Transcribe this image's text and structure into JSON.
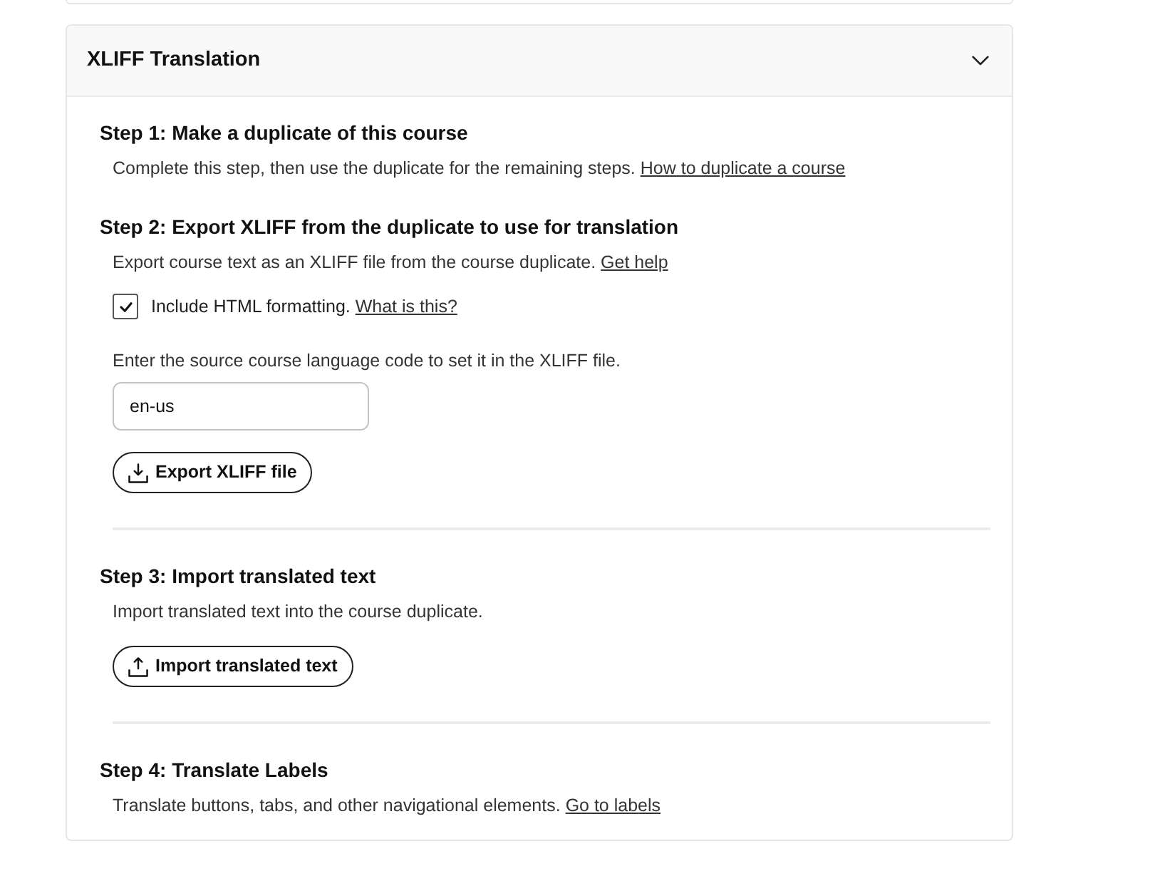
{
  "section": {
    "title": "XLIFF Translation",
    "expanded": true
  },
  "steps": [
    {
      "heading": "Step 1: Make a duplicate of this course",
      "divider_above": false,
      "description": "Complete this step, then use the duplicate for the remaining steps.",
      "link": "How to duplicate a course"
    },
    {
      "heading": "Step 2: Export XLIFF from the duplicate to use for translation",
      "divider_above": false,
      "description": "Export course text as an XLIFF file from the course duplicate.",
      "link": "Get help",
      "checkbox": {
        "label": "Include HTML formatting.",
        "link": "What is this?",
        "checked": true
      },
      "field_label": "Enter the source course language code to set it in the XLIFF file.",
      "field": {
        "value": "en-us"
      },
      "button": {
        "label": "Export XLIFF file",
        "kind": "download"
      }
    },
    {
      "heading": "Step 3: Import translated text",
      "divider_above": true,
      "description": "Import translated text into the course duplicate.",
      "button": {
        "label": "Import translated text",
        "kind": "upload"
      }
    },
    {
      "heading": "Step 4: Translate Labels",
      "divider_above": true,
      "description": "Translate buttons, tabs, and other navigational elements.",
      "link": "Go to labels"
    }
  ]
}
